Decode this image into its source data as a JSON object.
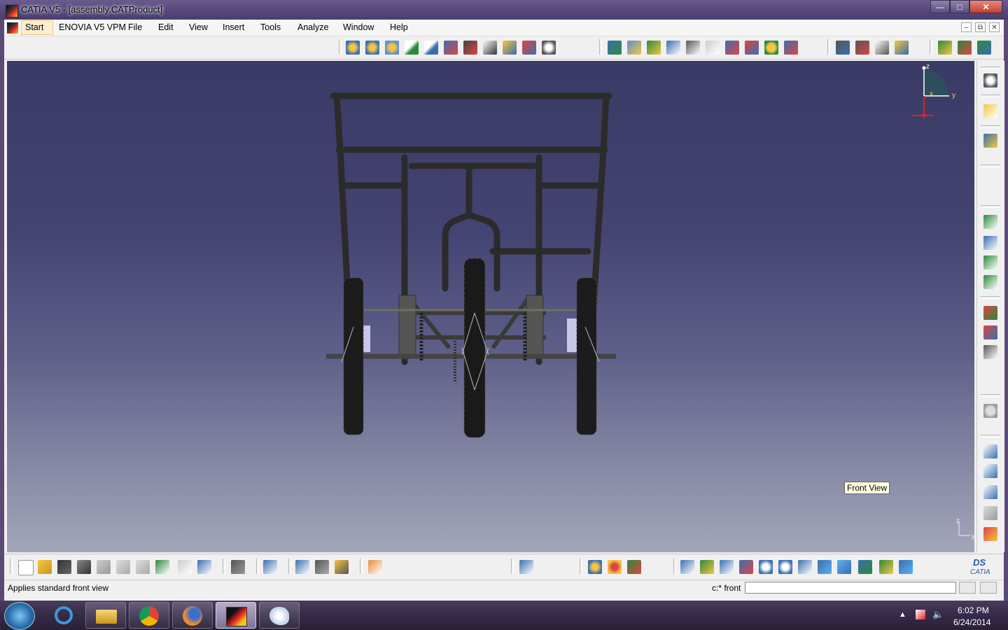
{
  "window": {
    "title": "CATIA V5 - [assembly.CATProduct]",
    "minimize": "—",
    "maximize": "□",
    "close": "✕"
  },
  "menu": {
    "items": [
      "Start",
      "ENOVIA V5 VPM",
      "File",
      "Edit",
      "View",
      "Insert",
      "Tools",
      "Analyze",
      "Window",
      "Help"
    ],
    "mdi_minimize": "–",
    "mdi_restore": "⧉",
    "mdi_close": "✕"
  },
  "compass": {
    "z": "z",
    "x": "x",
    "y": "y"
  },
  "viewport": {
    "tooltip": "Front View",
    "axis_z": "z",
    "axis_y": "y"
  },
  "statusbar": {
    "message": "Applies standard front view",
    "command_label": "c:* front",
    "command_value": ""
  },
  "taskbar": {
    "time": "6:02 PM",
    "date": "6/24/2014"
  },
  "bottom_logo": {
    "brand": "CATIA",
    "mark": "DS"
  }
}
